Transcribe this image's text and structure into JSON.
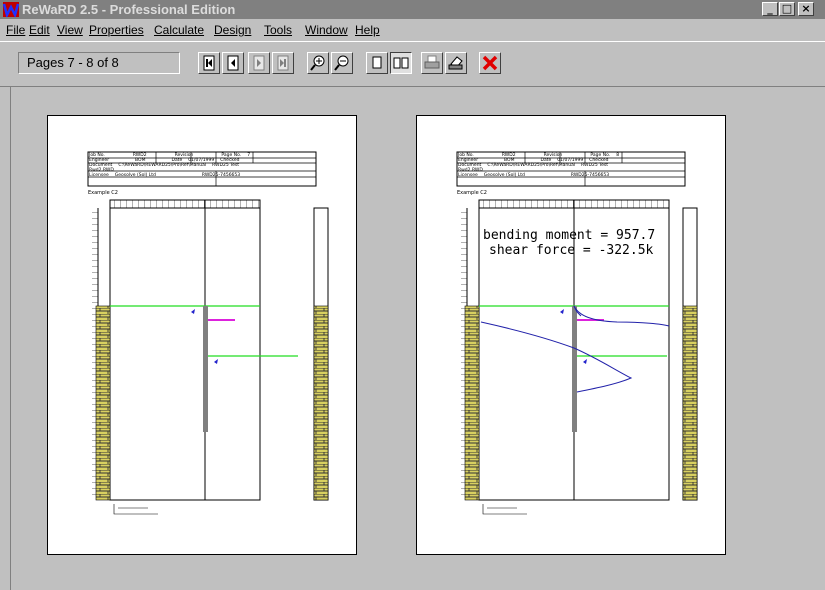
{
  "window": {
    "title": "ReWaRD 2.5 - Professional Edition",
    "controls": [
      "_",
      "□",
      "×"
    ]
  },
  "menu": [
    {
      "label": "File",
      "accel": "F"
    },
    {
      "label": "Edit",
      "accel": "E"
    },
    {
      "label": "View",
      "accel": "V"
    },
    {
      "label": "Properties",
      "accel": "P"
    },
    {
      "label": "Calculate",
      "accel": "C"
    },
    {
      "label": "Design",
      "accel": "D"
    },
    {
      "label": "Tools",
      "accel": "T"
    },
    {
      "label": "Window",
      "accel": "W"
    },
    {
      "label": "Help",
      "accel": "H"
    }
  ],
  "toolbar": {
    "pages_label": "Pages 7 - 8 of 8",
    "buttons": [
      "first-page-icon",
      "prev-page-icon",
      "next-page-icon",
      "last-page-icon",
      "zoom-in-icon",
      "zoom-out-icon",
      "one-page-icon",
      "two-page-icon",
      "print-setup-icon",
      "print-icon",
      "close-preview-icon"
    ]
  },
  "preview": {
    "left_page": {
      "header": {
        "job_no_label": "Job No.",
        "job_no": "RWD2",
        "revision_label": "Revision",
        "page_no_label": "Page No.",
        "page_no": "7",
        "engineer_label": "Engineer",
        "engineer": "BOM",
        "date_label": "Date",
        "date": "01/07/1999",
        "checked_label": "Checked",
        "document_label": "Document",
        "document": "C:\\ReWaRD\\REWARD25\\Pro\\Ref\\Manual",
        "project": "Rwd2.RWD",
        "file": "RWD25 Test",
        "licensee_label": "Licensee",
        "licensee": "Geosolve (Sol) Ltd",
        "version": "RWD25-7456653"
      },
      "example_label": "Example C2"
    },
    "right_page": {
      "header": {
        "job_no_label": "Job No.",
        "job_no": "RWD2",
        "revision_label": "Revision",
        "page_no_label": "Page No.",
        "page_no": "8",
        "engineer_label": "Engineer",
        "engineer": "BOM",
        "date_label": "Date",
        "date": "01/07/1999",
        "checked_label": "Checked",
        "document_label": "Document",
        "document": "C:\\ReWaRD\\REWARD25\\Pro\\Ref\\Manual",
        "project": "Rwd2.RWD",
        "file": "RWD25 Test",
        "licensee_label": "Licensee",
        "licensee": "Geosolve (Sol) Ltd",
        "version": "RWD25-7456653"
      },
      "example_label": "Example C2",
      "annotation_moment": "bending moment = 957.7",
      "annotation_shear": "shear force = -322.5k"
    }
  },
  "colors": {
    "ground_line": "#22dd22",
    "strut": "#dd22dd",
    "curve": "#2222aa",
    "soil": "#d8d060"
  }
}
